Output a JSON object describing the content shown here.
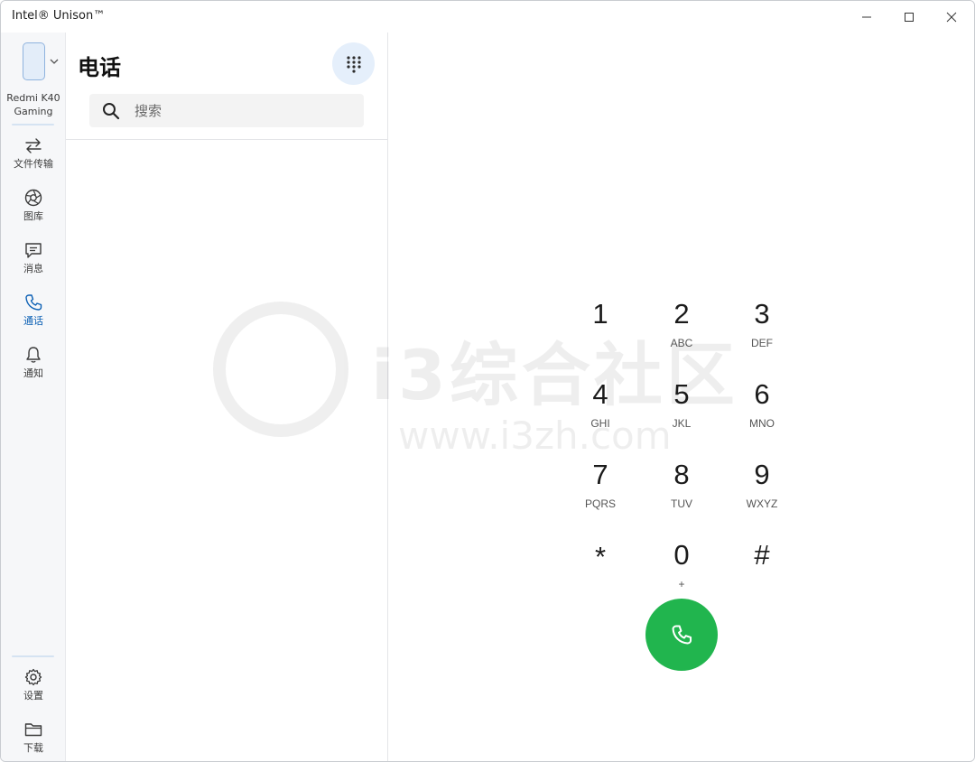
{
  "window": {
    "title": "Intel® Unison™"
  },
  "device": {
    "name": "Redmi K40 Gaming"
  },
  "nav": {
    "items": [
      {
        "id": "file-transfer",
        "label": "文件传输"
      },
      {
        "id": "gallery",
        "label": "图库"
      },
      {
        "id": "messages",
        "label": "消息"
      },
      {
        "id": "calls",
        "label": "通话",
        "active": true
      },
      {
        "id": "notifications",
        "label": "通知"
      }
    ],
    "bottom": [
      {
        "id": "settings",
        "label": "设置"
      },
      {
        "id": "downloads",
        "label": "下载"
      }
    ]
  },
  "phone": {
    "title": "电话",
    "search_placeholder": "搜索"
  },
  "dialpad": {
    "keys": [
      {
        "digit": "1",
        "letters": ""
      },
      {
        "digit": "2",
        "letters": "ABC"
      },
      {
        "digit": "3",
        "letters": "DEF"
      },
      {
        "digit": "4",
        "letters": "GHI"
      },
      {
        "digit": "5",
        "letters": "JKL"
      },
      {
        "digit": "6",
        "letters": "MNO"
      },
      {
        "digit": "7",
        "letters": "PQRS"
      },
      {
        "digit": "8",
        "letters": "TUV"
      },
      {
        "digit": "9",
        "letters": "WXYZ"
      },
      {
        "digit": "*",
        "letters": ""
      },
      {
        "digit": "0",
        "letters": "+"
      },
      {
        "digit": "#",
        "letters": ""
      }
    ]
  },
  "watermark": {
    "text": "i3综合社区",
    "url": "www.i3zh.com"
  },
  "colors": {
    "accent": "#0a5fb4",
    "call_green": "#21b54e",
    "rail_bg": "#f6f7f9"
  },
  "icons": {
    "file-transfer": "arrows-swap-icon",
    "gallery": "aperture-icon",
    "messages": "chat-bubble-icon",
    "calls": "phone-icon",
    "notifications": "bell-icon",
    "settings": "gear-icon",
    "downloads": "folder-icon"
  }
}
